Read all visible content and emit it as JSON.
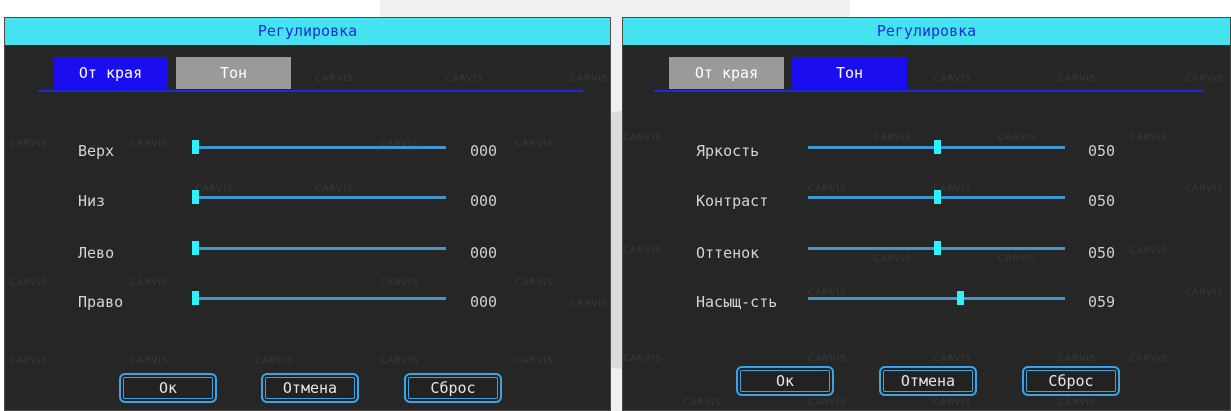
{
  "left": {
    "title": "Регулировка",
    "tabs": [
      {
        "label": "От края",
        "active": true
      },
      {
        "label": "Тон",
        "active": false
      }
    ],
    "rows": [
      {
        "label": "Верх",
        "value": "000",
        "level": 0
      },
      {
        "label": "Низ",
        "value": "000",
        "level": 0
      },
      {
        "label": "Лево",
        "value": "000",
        "level": 0
      },
      {
        "label": "Право",
        "value": "000",
        "level": 0
      }
    ],
    "buttons": {
      "ok": "Ок",
      "cancel": "Отмена",
      "reset": "Сброс"
    }
  },
  "right": {
    "title": "Регулировка",
    "tabs": [
      {
        "label": "От края",
        "active": false
      },
      {
        "label": "Тон",
        "active": true
      }
    ],
    "rows": [
      {
        "label": "Яркость",
        "value": "050",
        "level": 50
      },
      {
        "label": "Контраст",
        "value": "050",
        "level": 50
      },
      {
        "label": "Оттенок",
        "value": "050",
        "level": 50
      },
      {
        "label": "Насыщ-сть",
        "value": "059",
        "level": 59
      }
    ],
    "buttons": {
      "ok": "Ок",
      "cancel": "Отмена",
      "reset": "Сброс"
    }
  },
  "watermark": "CARVIS",
  "colors": {
    "title_bar": "#45e3f0",
    "tab_active": "#1a0df0",
    "tab_inactive": "#9a9a9a",
    "slider_track": "#3f97d2",
    "slider_thumb": "#2ff0ff",
    "button_border": "#3aa4e4",
    "panel_bg": "#262626"
  }
}
